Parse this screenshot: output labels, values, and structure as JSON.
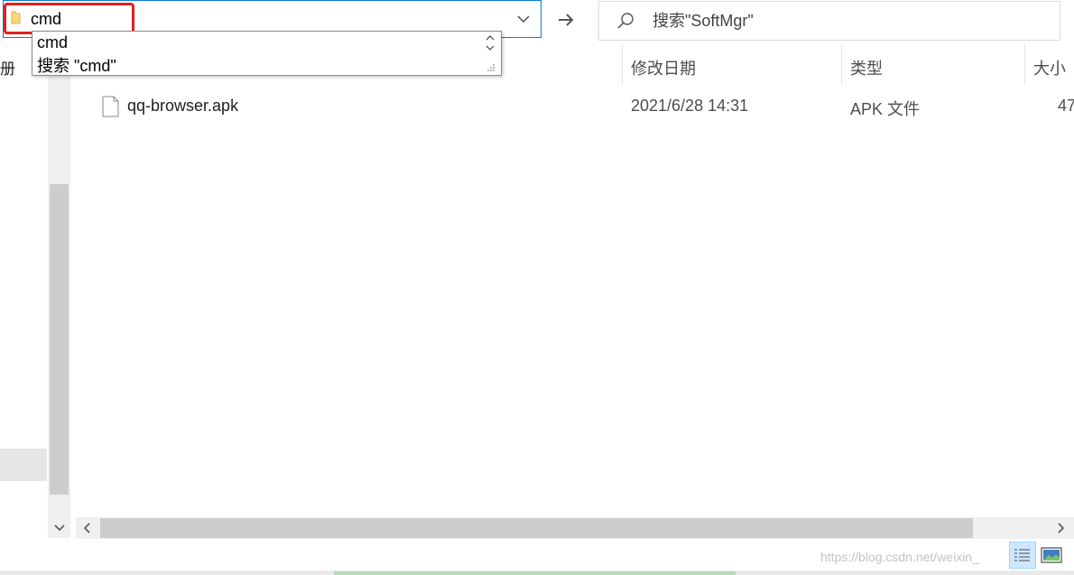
{
  "address_bar": {
    "value": "cmd",
    "folder_icon": "folder-icon",
    "dropdown_icon": "chevron-down-icon"
  },
  "go_button": {
    "icon": "arrow-right-icon"
  },
  "search": {
    "placeholder": "搜索\"SoftMgr\"",
    "icon": "search-icon"
  },
  "autocomplete": {
    "items": [
      "cmd",
      "搜索 \"cmd\""
    ]
  },
  "navigation": {
    "visible_label": "册"
  },
  "columns": {
    "modified": "修改日期",
    "type": "类型",
    "size": "大小"
  },
  "files": [
    {
      "name": "qq-browser.apk",
      "modified": "2021/6/28 14:31",
      "type": "APK 文件",
      "size": "47"
    }
  ],
  "status_bar": {
    "watermark": "https://blog.csdn.net/weixin_"
  },
  "colors": {
    "focus_border": "#0a78d7",
    "highlight_box": "#e3201c",
    "view_selected": "#cce8ff"
  }
}
